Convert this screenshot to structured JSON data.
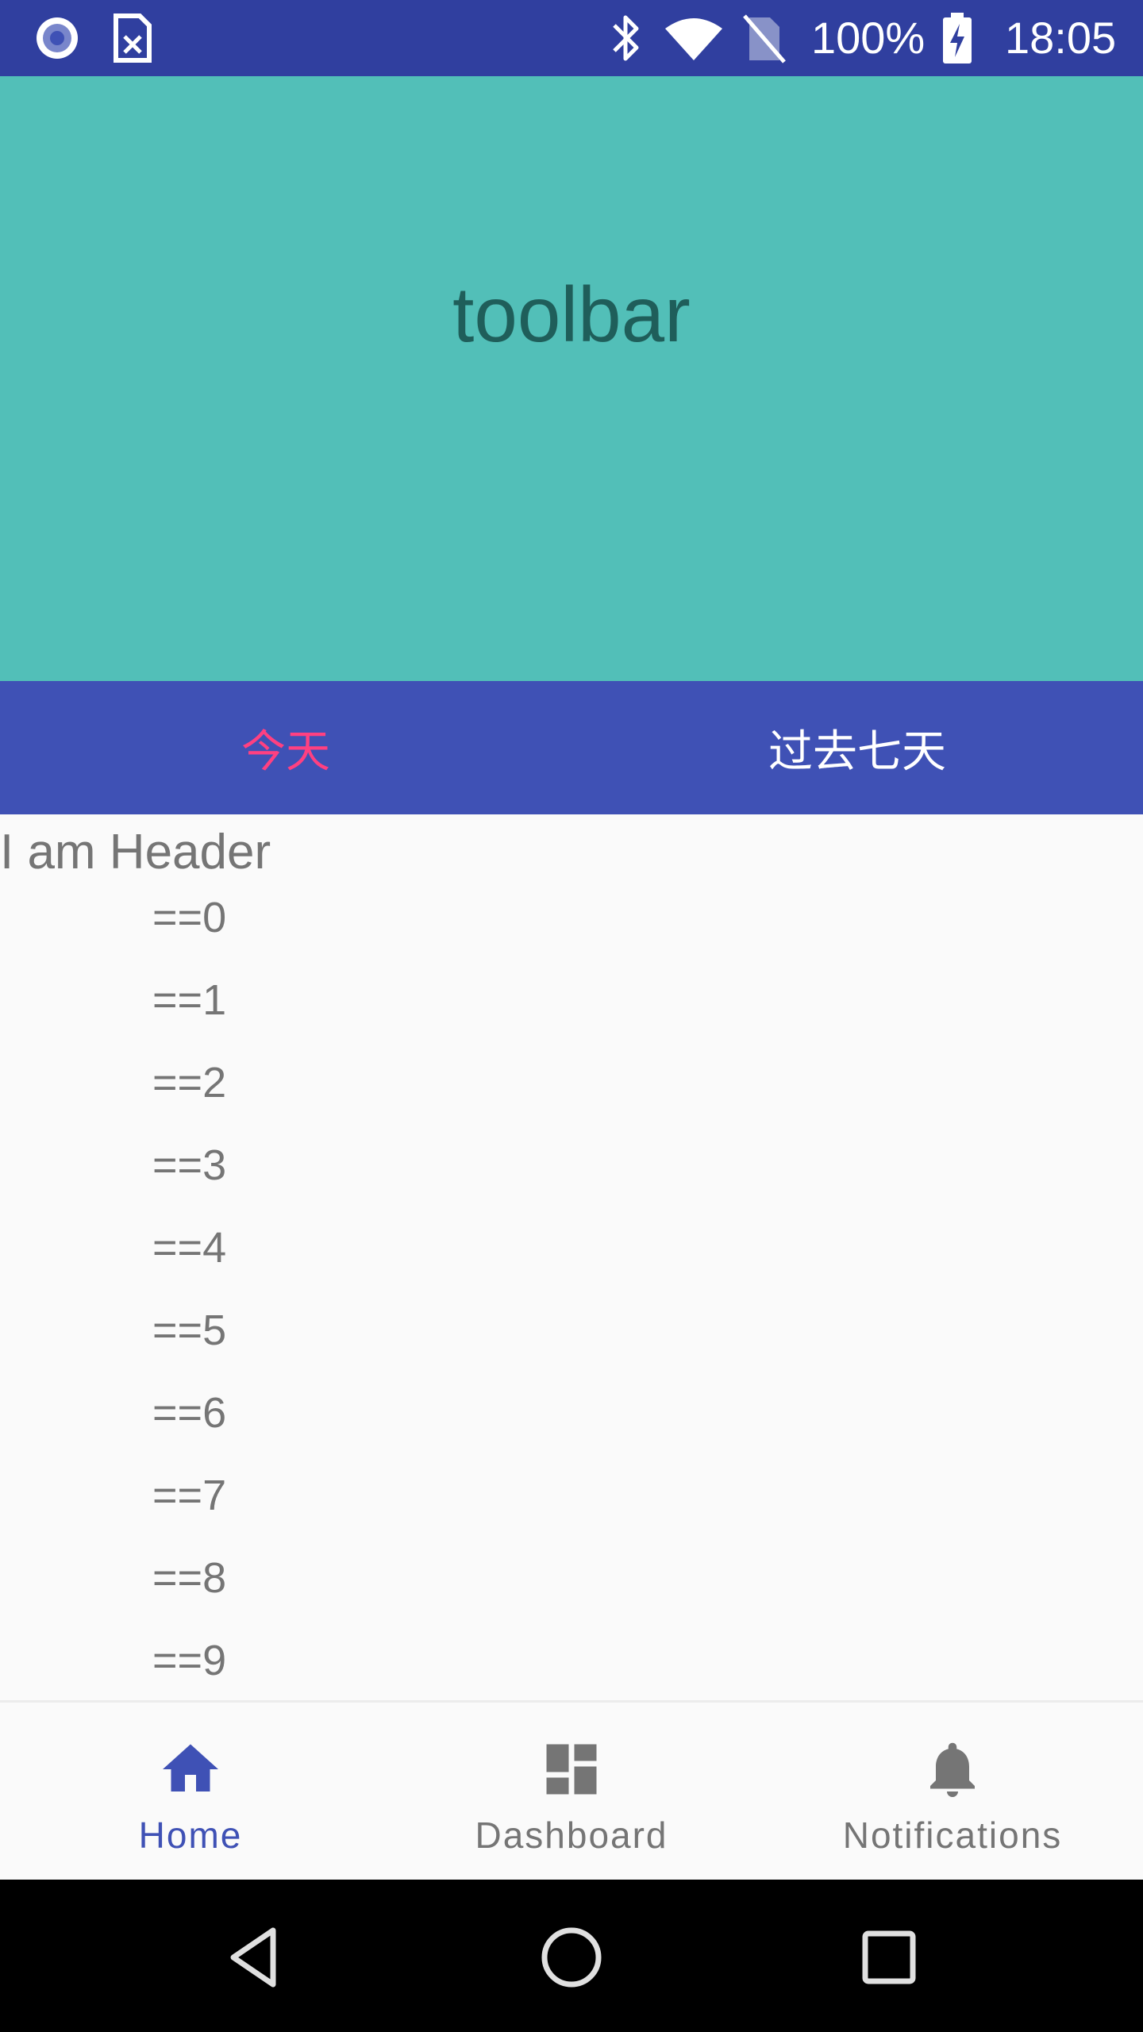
{
  "status_bar": {
    "battery_percent": "100%",
    "time": "18:05",
    "icons": [
      "notification-circle-icon",
      "sim-card-icon",
      "bluetooth-icon",
      "wifi-icon",
      "no-sim-icon",
      "battery-charging-icon"
    ]
  },
  "toolbar": {
    "title": "toolbar"
  },
  "tabs": [
    {
      "label": "今天",
      "active": true
    },
    {
      "label": "过去七天",
      "active": false
    }
  ],
  "content": {
    "header": "I am Header",
    "items": [
      "==0",
      "==1",
      "==2",
      "==3",
      "==4",
      "==5",
      "==6",
      "==7",
      "==8",
      "==9"
    ]
  },
  "bottom_nav": [
    {
      "label": "Home",
      "icon": "home-icon",
      "active": true
    },
    {
      "label": "Dashboard",
      "icon": "dashboard-icon",
      "active": false
    },
    {
      "label": "Notifications",
      "icon": "bell-icon",
      "active": false
    }
  ],
  "colors": {
    "status_bar": "#303f9f",
    "toolbar_bg": "#52bfb8",
    "toolbar_text": "#1f5e5a",
    "tab_bg": "#3f51b5",
    "tab_active": "#ff4081",
    "primary": "#3f51b5",
    "text_secondary": "#757575"
  }
}
